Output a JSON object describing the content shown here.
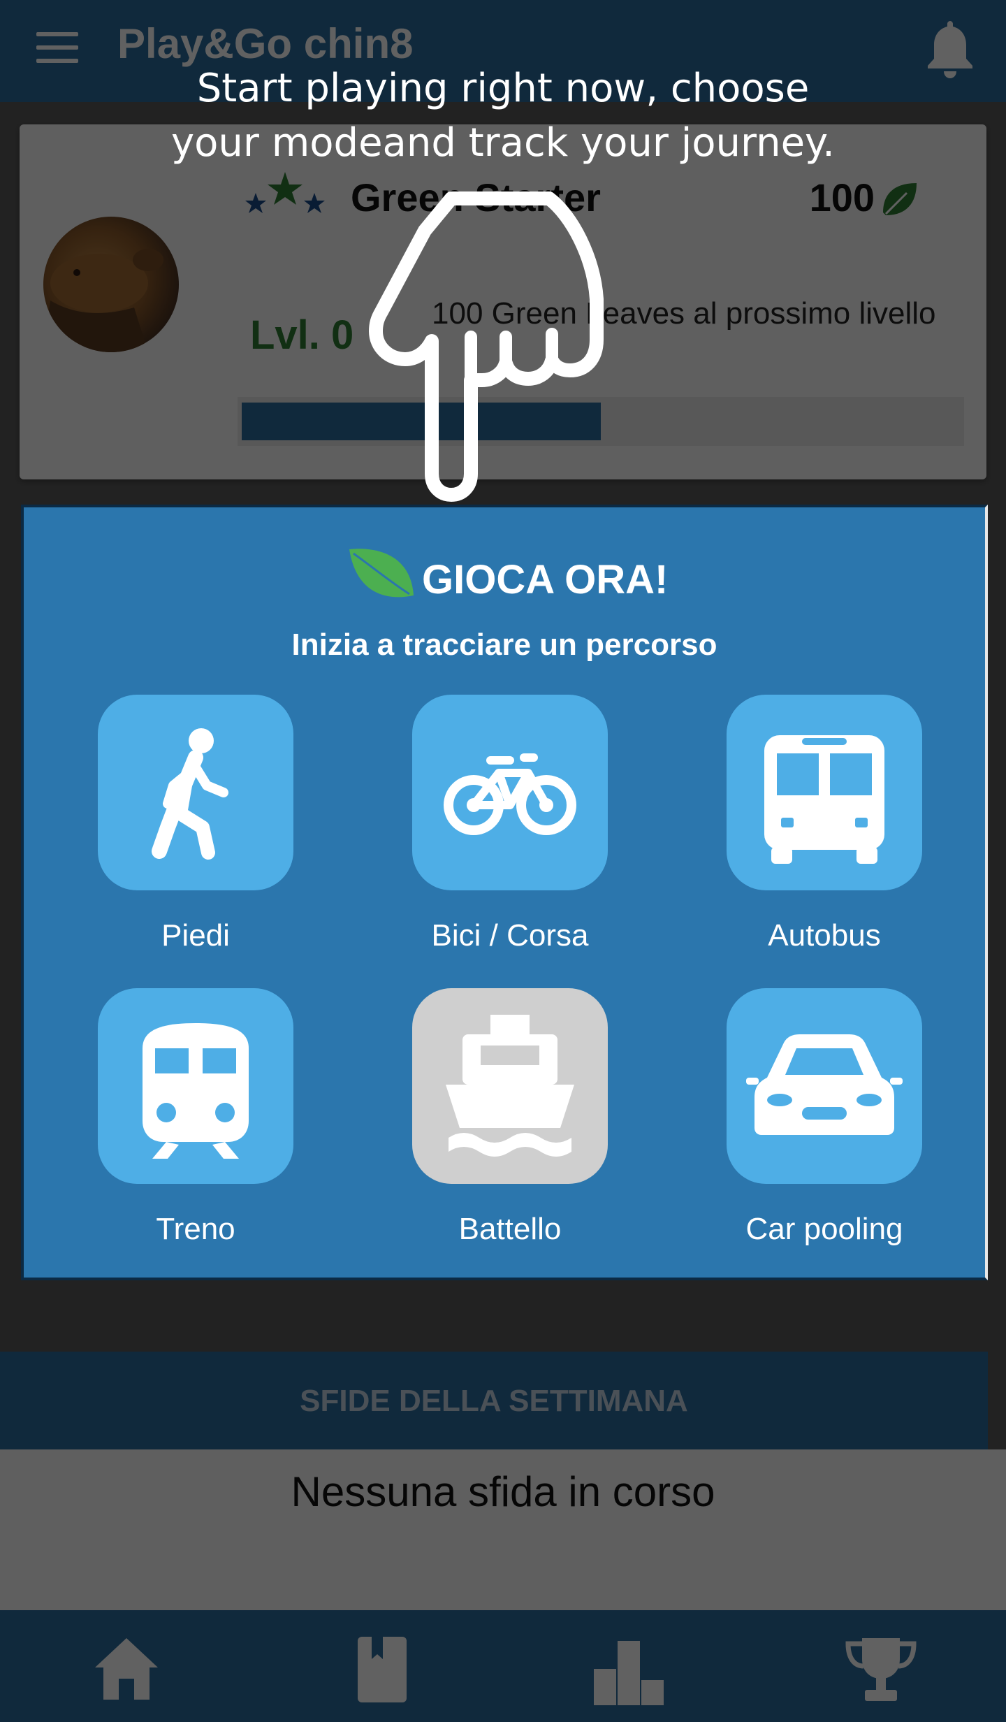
{
  "app_bar": {
    "title": "Play&Go chin8",
    "menu_icon": "hamburger-menu-icon",
    "notifications_icon": "bell-icon"
  },
  "profile": {
    "badge_name": "Green Starter",
    "points": "100",
    "points_icon": "green-leaf-icon",
    "level": "Lvl. 0",
    "next_level_text": "100 Green Leaves al prossimo livello",
    "progress": 0.5
  },
  "play_now": {
    "title": "GIOCA ORA!",
    "subtitle": "Inizia a tracciare un percorso",
    "modes": [
      {
        "label": "Piedi",
        "icon": "walk-icon",
        "enabled": true
      },
      {
        "label": "Bici / Corsa",
        "icon": "bike-icon",
        "enabled": true
      },
      {
        "label": "Autobus",
        "icon": "bus-icon",
        "enabled": true
      },
      {
        "label": "Treno",
        "icon": "train-icon",
        "enabled": true
      },
      {
        "label": "Battello",
        "icon": "boat-icon",
        "enabled": false
      },
      {
        "label": "Car pooling",
        "icon": "car-icon",
        "enabled": true
      }
    ]
  },
  "challenges": {
    "title": "SFIDE DELLA SETTIMANA",
    "empty_text": "Nessuna sfida in corso"
  },
  "bottom_nav": [
    {
      "icon": "home-icon"
    },
    {
      "icon": "diary-icon"
    },
    {
      "icon": "leaderboard-icon"
    },
    {
      "icon": "trophy-icon"
    }
  ],
  "tutorial": {
    "text_line1": "Start playing right now, choose",
    "text_line2": "your modeand track your journey.",
    "pointer_icon": "pointing-hand-icon"
  },
  "colors": {
    "primary": "#2a6d9f",
    "panel": "#2b76ad",
    "tile": "#4eaee6",
    "tile_disabled": "#cfcfcf",
    "level_green": "#2e7d32",
    "leaf_green": "#4caf50"
  }
}
